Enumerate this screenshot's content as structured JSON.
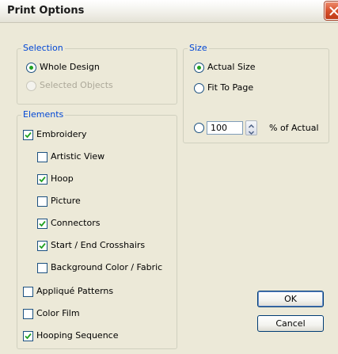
{
  "window": {
    "title": "Print Options"
  },
  "selection": {
    "legend": "Selection",
    "options": [
      {
        "label": "Whole Design",
        "checked": true,
        "enabled": true
      },
      {
        "label": "Selected Objects",
        "checked": false,
        "enabled": false
      }
    ]
  },
  "size": {
    "legend": "Size",
    "options": [
      {
        "label": "Actual Size",
        "checked": true
      },
      {
        "label": "Fit To Page",
        "checked": false
      },
      {
        "label": "",
        "checked": false
      }
    ],
    "percent_value": "100",
    "percent_label": "% of Actual"
  },
  "elements": {
    "legend": "Elements",
    "items": [
      {
        "label": "Embroidery",
        "checked": true
      },
      {
        "label": "Artistic View",
        "checked": false
      },
      {
        "label": "Hoop",
        "checked": true
      },
      {
        "label": "Picture",
        "checked": false
      },
      {
        "label": "Connectors",
        "checked": true
      },
      {
        "label": "Start / End Crosshairs",
        "checked": true
      },
      {
        "label": "Background Color / Fabric",
        "checked": false
      },
      {
        "label": "Appliqué Patterns",
        "checked": false
      },
      {
        "label": "Color Film",
        "checked": false
      },
      {
        "label": "Hooping Sequence",
        "checked": true
      }
    ]
  },
  "buttons": {
    "ok": "OK",
    "cancel": "Cancel"
  },
  "colors": {
    "legend": "#0046d5",
    "radio_dot": "#21a121",
    "checkmark": "#21a121",
    "close": "#d8512d"
  },
  "icons": {
    "close": "close-icon",
    "spin_up": "arrow-up-icon",
    "spin_down": "arrow-down-icon"
  }
}
